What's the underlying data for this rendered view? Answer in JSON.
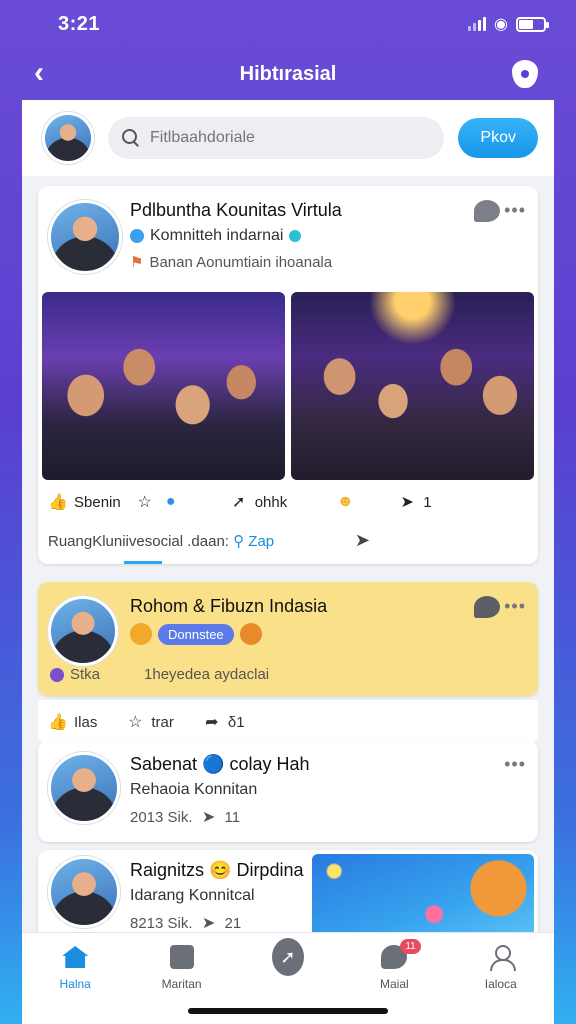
{
  "status_bar": {
    "time": "3:21"
  },
  "header": {
    "title": "Hibtırasial"
  },
  "search": {
    "placeholder": "Fitlbaahdoriale",
    "post_label": "Pkov"
  },
  "post1": {
    "title": "Pdlbuntha Kounitas Virtula",
    "subtitle": "Komnitteh indarnai",
    "meta": "Banan Aonumtiain ihoanala",
    "actions": {
      "like": "Sbenin",
      "share": "ohhk",
      "count": "1"
    },
    "footer_text": "RuangKluniivesocial .daan:",
    "footer_link": "Zap"
  },
  "post2": {
    "title": "Rohom & Fibuzn Indasia",
    "pill": "Donnstee",
    "tag": "Stka",
    "meta": "1heyedea aydaclai",
    "actions": {
      "like": "Ilas",
      "star": "trar",
      "share": "δ1"
    }
  },
  "post3": {
    "title": "Sabenat 🔵 colay Hah",
    "subtitle": "Rehaoia Konnitan",
    "stats": "2013 Sik.",
    "share": "11"
  },
  "post4": {
    "title": "Raignitzs 😊 Dirpdina",
    "subtitle": "Idarang Konnitcal",
    "stats": "8213 Sik.",
    "share": "21"
  },
  "nav": [
    {
      "label": "Halna",
      "icon": "home-icon"
    },
    {
      "label": "Maritan",
      "icon": "box-icon"
    },
    {
      "label": "",
      "icon": "compose-icon"
    },
    {
      "label": "Maial",
      "icon": "chat-icon",
      "badge": "11"
    },
    {
      "label": "Ialoca",
      "icon": "profile-icon"
    }
  ],
  "colors": {
    "accent": "#1a8fe0",
    "yellow_card": "#fbe08a",
    "gradient_top": "#6a4cd6",
    "gradient_bottom": "#2fb0f0"
  }
}
